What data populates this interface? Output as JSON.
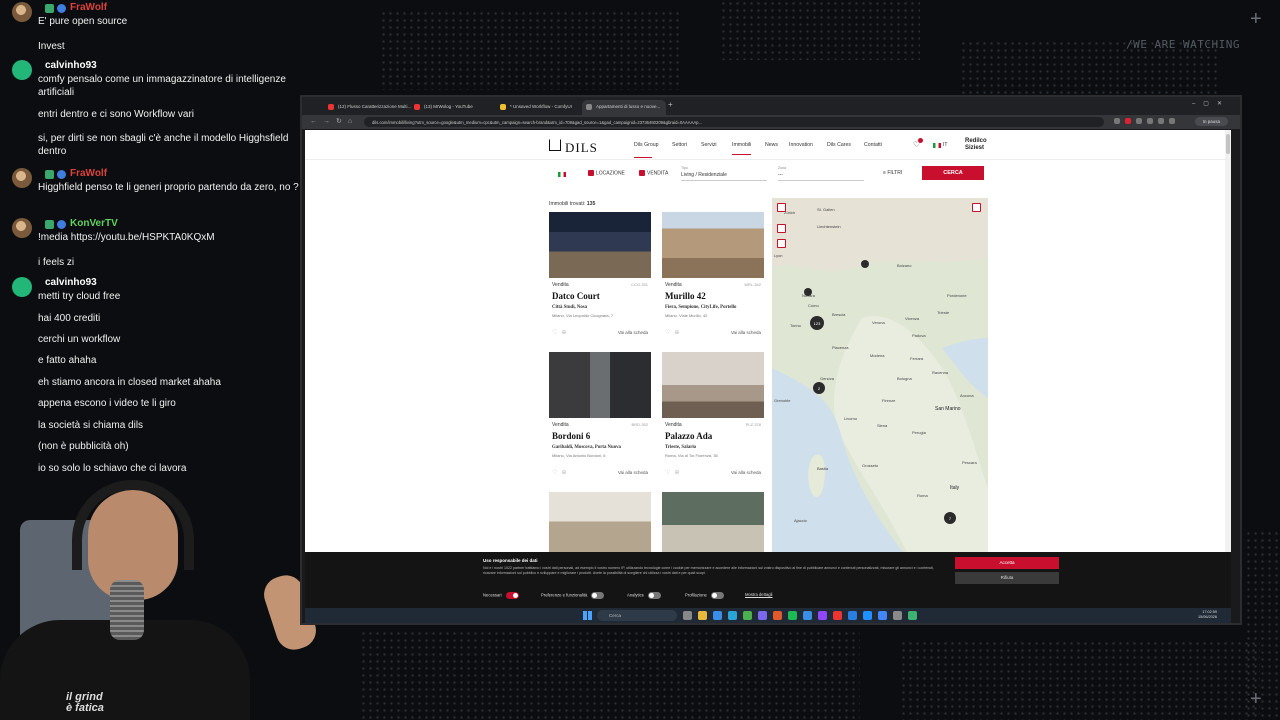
{
  "stream": {
    "slogan": "/WE ARE WATCHING",
    "cam_text_1": "il grind",
    "cam_text_2": "è fatica"
  },
  "chat": [
    {
      "user": "FraWolf",
      "text": "E' pure open source"
    },
    {
      "user": "",
      "text": "Invest"
    },
    {
      "user": "calvinho93",
      "text": "comfy pensalo come un immagazzinatore di intelligenze artificiali"
    },
    {
      "user": "",
      "text": "entri dentro e ci sono Workflow vari"
    },
    {
      "user": "",
      "text": "si, per dirti se non sbagli c'è anche il modello Higghsfield dentro"
    },
    {
      "user": "FraWolf",
      "text": "Higghfield penso te li generi proprio partendo da zero, no ?"
    },
    {
      "user": "KonVerTV",
      "text": "!media https://youtu.be/HSPKTA0KQxM"
    },
    {
      "user": "",
      "text": "i feels zi"
    },
    {
      "user": "calvinho93",
      "text": "metti try cloud free"
    },
    {
      "user": "",
      "text": "hai 400 crediti"
    },
    {
      "user": "",
      "text": "cerchi un workflow"
    },
    {
      "user": "",
      "text": "e fatto ahaha"
    },
    {
      "user": "",
      "text": "eh stiamo ancora in closed market ahaha"
    },
    {
      "user": "",
      "text": "appena escono i video te li giro"
    },
    {
      "user": "",
      "text": "la società si chiama dils"
    },
    {
      "user": "",
      "text": "(non è pubblicità oh)"
    },
    {
      "user": "",
      "text": "io so solo lo schiavo che ci lavora"
    }
  ],
  "browser": {
    "tabs": [
      {
        "label": "(12) Flusso Caratterizzazione Multi..."
      },
      {
        "label": "(13) MrWolog - YouTube"
      },
      {
        "label": "* Unsaved Workflow - ComfyUI"
      },
      {
        "label": "Appartamenti di lusso e nuove..."
      }
    ],
    "url": "dils.com/immobili/living?utm_source=google&utm_medium=cpc&utm_campaign=search-brand&utm_id=708&gad_source=1&gad_campaignid=23736460209&gbraid=0AAAAAp...",
    "paused_label": "In pausa"
  },
  "site": {
    "logo": "DILS",
    "nav": [
      "Dils Group",
      "Settori",
      "Servizi",
      "Immobili",
      "News",
      "Innovation",
      "Dils Cares",
      "Contatti"
    ],
    "lang": "IT",
    "brand_right_1": "Redilco",
    "brand_right_2": "Siziest",
    "filters": {
      "location_label": "LOCAZIONE",
      "sale_label": "VENDITA",
      "type_small": "Tipo",
      "type_value": "Living / Residenziale",
      "area_small": "Zona",
      "area_value": "---",
      "filters_label": "FILTRI",
      "search_button": "CERCA"
    },
    "found_label": "Immobili trovati:",
    "found_count": "135",
    "listings": [
      {
        "tipo": "Vendita",
        "code": "CCG-331",
        "name": "Datco Court",
        "zone": "Città Studi, Nosa",
        "addr": "Milano, Via Leopoldo Cicognara, 7",
        "link": "Vai alla scheda"
      },
      {
        "tipo": "Vendita",
        "code": "MRL-342",
        "name": "Murillo 42",
        "zone": "Fiera, Sempione, CityLife, Portello",
        "addr": "Milano, Viale Murillo, 42",
        "link": "Vai alla scheda"
      },
      {
        "tipo": "Vendita",
        "code": "BRD-352",
        "name": "Bordoni 6",
        "zone": "Garibaldi, Moscova, Porta Nuova",
        "addr": "Milano, Via Antonio Bordoni, 6",
        "link": "Vai alla scheda"
      },
      {
        "tipo": "Vendita",
        "code": "PLZ-378",
        "name": "Palazzo Ada",
        "zone": "Trieste, Salario",
        "addr": "Roma, Via di Tor Fiorenza, 35",
        "link": "Vai alla scheda"
      }
    ],
    "map": {
      "labels": [
        "Zürich",
        "St. Gallen",
        "Liechtenstein",
        "Bolzano",
        "Pordenone",
        "Trieste",
        "Brescia",
        "Verona",
        "Vicenza",
        "Padova",
        "Torino",
        "Piacenza",
        "Modena",
        "Ferrara",
        "Ravenna",
        "Bologna",
        "Genova",
        "Firenze",
        "San Marino",
        "Perugia",
        "Pescara",
        "Grosseto",
        "Bastia",
        "Ajaccio",
        "Roma",
        "Italy",
        "Lyon",
        "Grenoble",
        "Como",
        "Novara",
        "Livorno",
        "Siena",
        "Ancona"
      ],
      "clusters": [
        {
          "count": "123"
        },
        {
          "count": "2"
        },
        {
          "count": "7"
        },
        {
          "count": ""
        },
        {
          "count": ""
        }
      ]
    }
  },
  "cookie": {
    "title": "Uso responsabile dei dati",
    "text": "Noi e i nostri 1022 partner trattiamo i vostri dati personali, ad esempio il vostro numero IP, utilizzando tecnologie come i cookie per memorizzare e accedere alle informazioni sul vostro dispositivo al fine di pubblicare annunci e contenuti personalizzati, misurare gli annunci e i contenuti, ricavare informazioni sul pubblico e sviluppare e migliorare i prodotti. Avete la possibilità di scegliere chi utilizza i vostri dati e per quali scopi.",
    "accept": "Accetta",
    "reject": "Rifiuta",
    "toggles": [
      {
        "label": "Necessari",
        "on": true
      },
      {
        "label": "Preferenze e funzionalità",
        "on": false
      },
      {
        "label": "Analytics",
        "on": false
      },
      {
        "label": "Profilazione",
        "on": false
      }
    ],
    "details": "Mostra dettagli"
  },
  "taskbar": {
    "search_placeholder": "Cerca",
    "time": "17:02:59",
    "date": "15/06/2026"
  }
}
